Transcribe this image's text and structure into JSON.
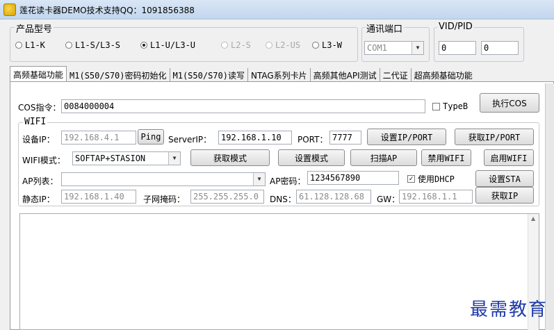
{
  "window": {
    "title": "莲花读卡器DEMO技术支持QQ：1091856388",
    "icon": "lotus-app-icon"
  },
  "product_model": {
    "legend": "产品型号",
    "options": [
      {
        "label": "L1-K",
        "selected": false,
        "enabled": true
      },
      {
        "label": "L1-S/L3-S",
        "selected": false,
        "enabled": true
      },
      {
        "label": "L1-U/L3-U",
        "selected": true,
        "enabled": true
      },
      {
        "label": "L2-S",
        "selected": false,
        "enabled": false
      },
      {
        "label": "L2-US",
        "selected": false,
        "enabled": false
      },
      {
        "label": "L3-W",
        "selected": false,
        "enabled": true
      }
    ]
  },
  "comm_port": {
    "legend": "通讯端口",
    "value": "COM1"
  },
  "vid_pid": {
    "legend": "VID/PID",
    "vid": "0",
    "pid": "0"
  },
  "tabs": [
    {
      "label": "高频基础功能",
      "active": true
    },
    {
      "label": "M1(S50/S70)密码初始化",
      "active": false
    },
    {
      "label": "M1(S50/S70)读写",
      "active": false
    },
    {
      "label": "NTAG系列卡片",
      "active": false
    },
    {
      "label": "高频其他API测试",
      "active": false
    },
    {
      "label": "二代证",
      "active": false
    },
    {
      "label": "超高频基础功能",
      "active": false
    }
  ],
  "cos": {
    "label": "COS指令：",
    "value": "0084000004",
    "typeb_label": "TypeB",
    "typeb_checked": false,
    "exec_button": "执行COS"
  },
  "wifi": {
    "legend": "WIFI",
    "device_ip_label": "设备IP：",
    "device_ip": "192.168.4.1",
    "ping_button": "Ping",
    "server_ip_label": "ServerIP：",
    "server_ip": "192.168.1.10",
    "port_label": "PORT：",
    "port": "7777",
    "set_ip_port_button": "设置IP/PORT",
    "get_ip_port_button": "获取IP/PORT",
    "mode_label": "WIFI模式：",
    "mode_value": "SOFTAP+STASION",
    "get_mode_button": "获取模式",
    "set_mode_button": "设置模式",
    "scan_ap_button": "扫描AP",
    "disable_wifi_button": "禁用WIFI",
    "enable_wifi_button": "启用WIFI",
    "ap_list_label": "AP列表：",
    "ap_list_value": "",
    "ap_password_label": "AP密码：",
    "ap_password": "1234567890",
    "dhcp_label": "使用DHCP",
    "dhcp_checked": true,
    "set_sta_button": "设置STA",
    "static_ip_label": "静态IP：",
    "static_ip": "192.168.1.40",
    "subnet_label": "子网掩码：",
    "subnet": "255.255.255.0",
    "dns_label": "DNS：",
    "dns": "61.128.128.68",
    "gw_label": "GW：",
    "gw": "192.168.1.1",
    "get_ip_button": "获取IP"
  },
  "log": {
    "content": ""
  },
  "watermark": "最需教育"
}
